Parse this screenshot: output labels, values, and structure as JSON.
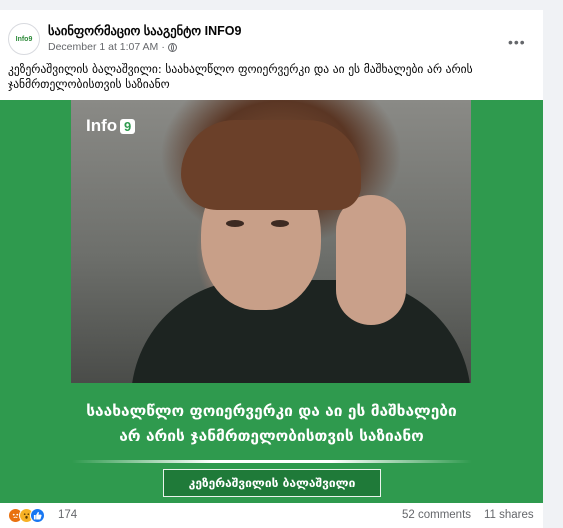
{
  "post": {
    "page_name": "საინფორმაციო სააგენტო INFO9",
    "avatar_text": "Info9",
    "timestamp": "December 1 at 1:07 AM",
    "more_label": "•••",
    "text": "კეზერაშვილის ბალაშვილი: საახალწლო ფოიერვერკი და აი ეს მაშხალები არ არის ჯანმრთელობისთვის საზიანო"
  },
  "image": {
    "logo_text": "Info",
    "logo_badge": "9",
    "headline_line1": "საახალწლო ფოიერვერკი და აი ეს მაშხალები",
    "headline_line2": "არ არის ჯანმრთელობისთვის საზიანო",
    "name_plate": "კეზერაშვილის ბალაშვილი"
  },
  "footer": {
    "reaction_count": "174",
    "comments": "52 comments",
    "shares": "11 shares",
    "reactions": [
      "angry-icon",
      "wow-icon",
      "like-icon"
    ]
  },
  "colors": {
    "green": "#2f9a4e",
    "text": "#050505",
    "muted": "#65676b"
  }
}
